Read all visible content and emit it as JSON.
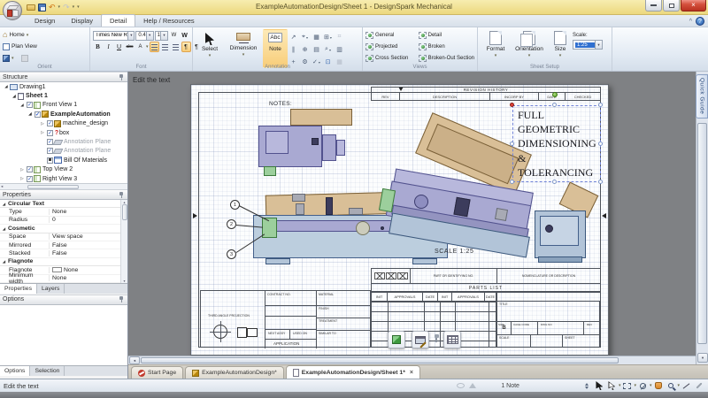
{
  "window": {
    "title": "ExampleAutomationDesign/Sheet 1 - DesignSpark Mechanical"
  },
  "glyphs": {
    "dropdown": "▾",
    "undo": "↶",
    "redo": "↷",
    "home": "⌂",
    "check": "✓",
    "expand_open": "◢",
    "expand_closed": "▷",
    "collapse_ribbon": "^",
    "help": "?",
    "left_arrow": "◂",
    "down_arrow": "▾",
    "up_arrow": "▴",
    "question": "?",
    "pilcrow": "¶",
    "close_tab": "×"
  },
  "ribbon_tabs": [
    "Design",
    "Display",
    "Detail",
    "Help / Resources"
  ],
  "ribbon": {
    "orient": {
      "caption": "Orient",
      "home": "Home",
      "plan_view": "Plan View"
    },
    "font": {
      "caption": "Font",
      "family": "Times New Roman",
      "size": "0.4",
      "width_factor": "1",
      "w1": "W",
      "w2": "W",
      "bold": "B",
      "italic": "I",
      "underline": "U",
      "strike": "abc",
      "kerning": "A"
    },
    "annotation": {
      "caption": "Annotation",
      "select": "Select",
      "dimension": "Dimension",
      "note": "Note",
      "note_glyph": "Abc",
      "glyphs": [
        "↗",
        "⌖",
        "▦",
        "⊞",
        "⌗",
        "∥",
        "⊕",
        "▤",
        "⌕",
        "▥",
        "+",
        "⚙",
        "✓",
        "⊡"
      ]
    },
    "views": {
      "caption": "Views",
      "col1": [
        "General",
        "Projected",
        "Cross Section"
      ],
      "col2": [
        "Detail",
        "Broken",
        "Broken-Out Section"
      ]
    },
    "sheet_setup": {
      "caption": "Sheet Setup",
      "format": "Format",
      "orientation": "Orientation",
      "size": "Size",
      "scale_label": "Scale:",
      "scale_value": "1:25"
    }
  },
  "structure_panel": {
    "title": "Structure",
    "items": [
      {
        "label": "Drawing1"
      },
      {
        "label": "Sheet 1"
      },
      {
        "label": "Front View 1"
      },
      {
        "label": "ExampleAutomation"
      },
      {
        "label": "machine_design"
      },
      {
        "label": "box"
      },
      {
        "label": "Annotation Plane"
      },
      {
        "label": "Annotation Plane"
      },
      {
        "label": "Bill Of Materials"
      },
      {
        "label": "Top View 2"
      },
      {
        "label": "Right View 3"
      }
    ]
  },
  "properties_panel": {
    "title": "Properties",
    "sections": [
      {
        "name": "Circular Text",
        "rows": [
          {
            "key": "Type",
            "value": "None"
          },
          {
            "key": "Radius",
            "value": "0"
          }
        ]
      },
      {
        "name": "Cosmetic",
        "rows": [
          {
            "key": "Space",
            "value": "View space"
          },
          {
            "key": "Mirrored",
            "value": "False"
          },
          {
            "key": "Stacked",
            "value": "False"
          }
        ]
      },
      {
        "name": "Flagnote",
        "rows": [
          {
            "key": "Flagnote",
            "value": "None"
          },
          {
            "key": "Minimum width",
            "value": "None"
          }
        ]
      }
    ],
    "tabs": [
      "Properties",
      "Layers"
    ]
  },
  "options_panel": {
    "title": "Options",
    "tabs": [
      "Options",
      "Selection"
    ]
  },
  "canvas": {
    "edit_hint": "Edit the text",
    "quick_guide": "Quick Guide"
  },
  "sheet": {
    "notes": "NOTES:",
    "revision": {
      "title": "REVISION HISTORY",
      "headers": [
        "REV",
        "DESCRIPTION",
        "INCORP BY",
        "DATE",
        "CHECKED"
      ]
    },
    "gdt_note": [
      "FULL",
      "GEOMETRIC",
      "DIMENSIONING",
      "&",
      "TOLERANCING"
    ],
    "scale_note": "SCALE  1:25",
    "balloons": [
      "1",
      "2",
      "3"
    ],
    "parts_list": {
      "title": "PARTS LIST",
      "part_no": "PART OR IDENTIFYING NO.",
      "nomenclature": "NOMENCLATURE OR DESCRIPTION",
      "approval_headers": [
        "INIT",
        "APPROVALS",
        "DATE",
        "INIT",
        "APPROVALS",
        "DATE"
      ]
    },
    "title_block": {
      "contract_no": "CONTRACT NO.",
      "material": "MATERIAL",
      "finish": "FINISH",
      "treatment": "TREATMENT",
      "similar_to": "SIMILAR TO",
      "projection": "THIRD ANGLE PROJECTION",
      "next_assy": "NEXT ASSY",
      "used_on": "USED ON",
      "application": "APPLICATION",
      "title": "TITLE",
      "size_label": "SIZE",
      "size_value": "B",
      "cage_code": "CAGE CODE",
      "dwg_no": "DWG NO",
      "rev": "REV",
      "scale": "SCALE",
      "sheet": "SHEET"
    }
  },
  "doc_tabs": [
    {
      "label": "Start Page"
    },
    {
      "label": "ExampleAutomationDesign*"
    },
    {
      "label": "ExampleAutomationDesign/Sheet 1*"
    }
  ],
  "status_bar": {
    "message": "Edit the text",
    "notes": "1 Note"
  }
}
